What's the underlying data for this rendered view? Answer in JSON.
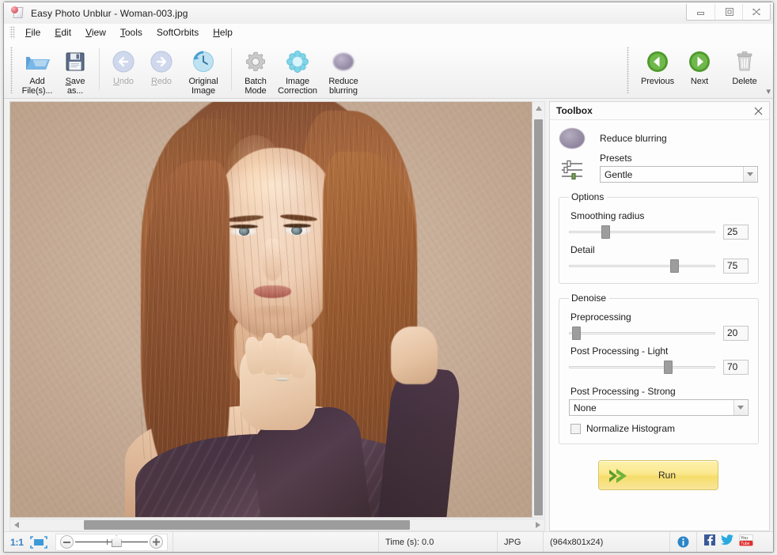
{
  "window": {
    "title": "Easy Photo Unblur - Woman-003.jpg",
    "app_icon": "photo-document-icon",
    "minimize": "minimize-button",
    "maximize": "maximize-button",
    "close": "close-button"
  },
  "menu": {
    "items": [
      {
        "label": "File",
        "accel": "F"
      },
      {
        "label": "Edit",
        "accel": "E"
      },
      {
        "label": "View",
        "accel": "V"
      },
      {
        "label": "Tools",
        "accel": "T"
      },
      {
        "label": "SoftOrbits",
        "accel": ""
      },
      {
        "label": "Help",
        "accel": "H"
      }
    ]
  },
  "toolbar": {
    "buttons": [
      {
        "name": "add-files",
        "line1": "Add",
        "line2": "File(s)...",
        "icon": "open-folder-icon",
        "disabled": false
      },
      {
        "name": "save-as",
        "line1": "Save",
        "line2": "as...",
        "icon": "floppy-save-icon",
        "disabled": false
      },
      {
        "name": "undo",
        "line1": "Undo",
        "line2": "",
        "icon": "undo-arrow-icon",
        "disabled": true
      },
      {
        "name": "redo",
        "line1": "Redo",
        "line2": "",
        "icon": "redo-arrow-icon",
        "disabled": true
      },
      {
        "name": "original-image",
        "line1": "Original",
        "line2": "Image",
        "icon": "clock-history-icon",
        "disabled": false
      },
      {
        "name": "batch-mode",
        "line1": "Batch",
        "line2": "Mode",
        "icon": "gear-icon",
        "disabled": false
      },
      {
        "name": "image-correction",
        "line1": "Image",
        "line2": "Correction",
        "icon": "color-wheel-icon",
        "disabled": false
      },
      {
        "name": "reduce-blurring",
        "line1": "Reduce",
        "line2": "blurring",
        "icon": "blur-ellipse-icon",
        "disabled": false
      }
    ],
    "right_buttons": [
      {
        "name": "previous",
        "label": "Previous",
        "icon": "green-left-arrow-icon"
      },
      {
        "name": "next",
        "label": "Next",
        "icon": "green-right-arrow-icon"
      },
      {
        "name": "delete",
        "label": "Delete",
        "icon": "trash-can-icon"
      }
    ],
    "overflow": "toolbar-overflow-chevron"
  },
  "toolbox": {
    "panel_title": "Toolbox",
    "close_icon": "close-icon",
    "tool_title": "Reduce blurring",
    "tool_icon": "blur-ellipse-icon",
    "presets": {
      "label": "Presets",
      "value": "Gentle",
      "icon": "sliders-icon",
      "dropdown_icon": "chevron-down-icon"
    },
    "options": {
      "legend": "Options",
      "controls": [
        {
          "name": "smoothing-radius",
          "label": "Smoothing radius",
          "value": "25",
          "percent": 25
        },
        {
          "name": "detail",
          "label": "Detail",
          "value": "75",
          "percent": 70
        }
      ]
    },
    "denoise": {
      "legend": "Denoise",
      "controls": [
        {
          "name": "preprocessing",
          "label": "Preprocessing",
          "value": "20",
          "percent": 3
        },
        {
          "name": "post-processing-light",
          "label": "Post Processing - Light",
          "value": "70",
          "percent": 67
        }
      ],
      "strong": {
        "label": "Post Processing - Strong",
        "value": "None",
        "dropdown_icon": "chevron-down-icon"
      },
      "normalize": {
        "label": "Normalize Histogram",
        "checked": false
      }
    },
    "run": {
      "label": "Run",
      "icon": "green-double-arrow-icon"
    }
  },
  "statusbar": {
    "ratio": "1:1",
    "fit_icon": "fit-to-window-icon",
    "zoom_out_icon": "minus-icon",
    "zoom_in_icon": "plus-icon",
    "zoom_home_icon": "zoom-home-handle-icon",
    "time": "Time (s): 0.0",
    "format": "JPG",
    "dimensions": "(964x801x24)",
    "info_icon": "info-icon",
    "facebook_icon": "facebook-icon",
    "twitter_icon": "twitter-icon",
    "youtube_icon": "youtube-icon",
    "resize_grip": "resize-grip"
  },
  "colors": {
    "accent_blue": "#3a7fc4",
    "green": "#5ba033",
    "run_yellow": "#f8e59a",
    "facebook": "#3b5998",
    "twitter": "#2aa9e0",
    "youtube": "#e02f2f"
  }
}
